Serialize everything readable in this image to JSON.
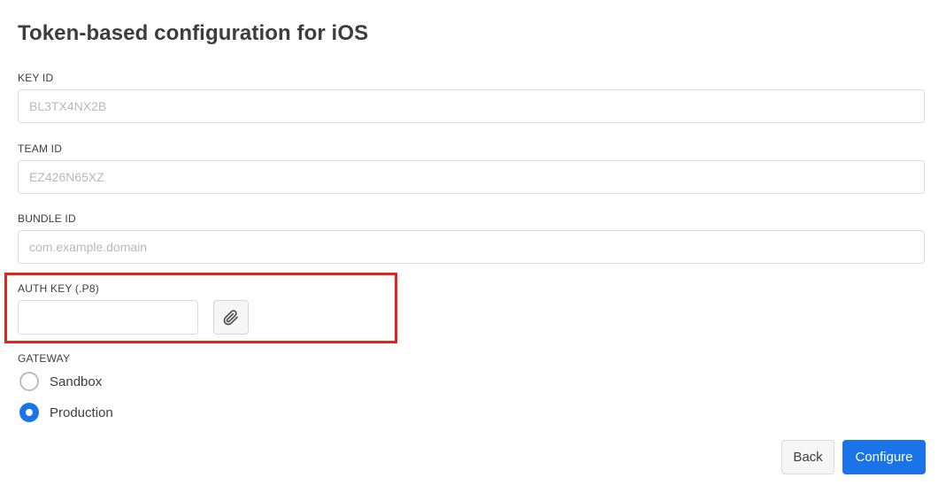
{
  "page": {
    "title": "Token-based configuration for iOS"
  },
  "fields": {
    "key_id": {
      "label": "KEY ID",
      "placeholder": "BL3TX4NX2B",
      "value": ""
    },
    "team_id": {
      "label": "TEAM ID",
      "placeholder": "EZ426N65XZ",
      "value": ""
    },
    "bundle_id": {
      "label": "BUNDLE ID",
      "placeholder": "com.example.domain",
      "value": ""
    },
    "auth_key": {
      "label": "AUTH KEY (.P8)",
      "value": "",
      "attach_icon": "paperclip-icon"
    }
  },
  "gateway": {
    "label": "GATEWAY",
    "options": [
      {
        "label": "Sandbox",
        "selected": false
      },
      {
        "label": "Production",
        "selected": true
      }
    ]
  },
  "actions": {
    "back_label": "Back",
    "configure_label": "Configure"
  },
  "colors": {
    "accent": "#1a73e8",
    "highlight": "#e0261b"
  }
}
